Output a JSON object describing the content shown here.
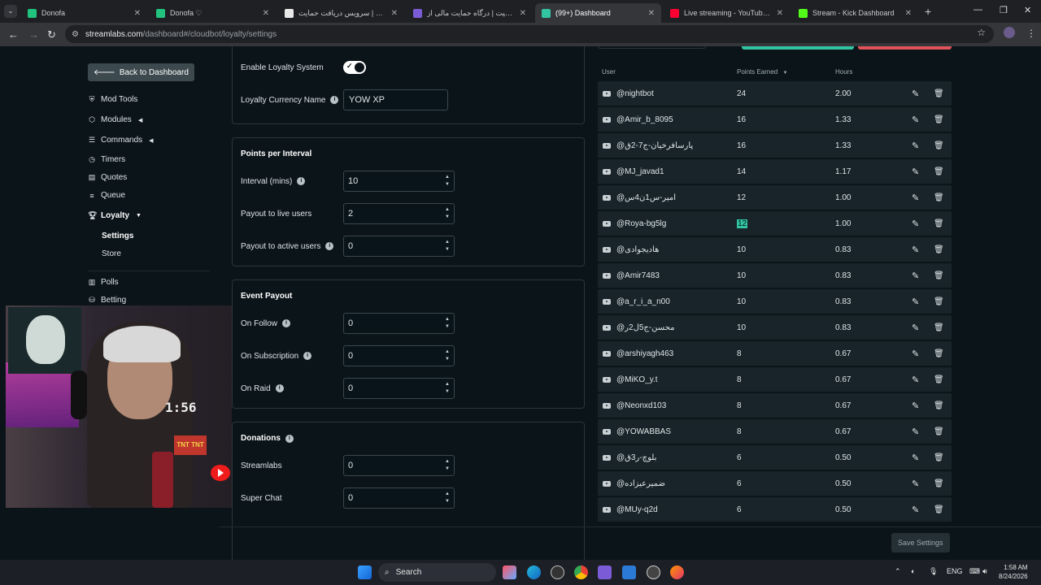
{
  "browser": {
    "tabs": [
      {
        "title": "Donofa",
        "color": "#21c37e"
      },
      {
        "title": "Donofa ♡",
        "color": "#21c37e"
      },
      {
        "title": "زیمیت | سرویس دریافت حمایت ...",
        "color": "#e8e8e8"
      },
      {
        "title": "زیمیت | درگاه حمایت مالی از yow",
        "color": "#7b5cd6"
      },
      {
        "title": "(99+) Dashboard",
        "color": "#31c3a2"
      },
      {
        "title": "Live streaming - YouTube Studio",
        "color": "#ff0033"
      },
      {
        "title": "Stream - Kick Dashboard",
        "color": "#53fc18"
      }
    ],
    "url_domain": "streamlabs.com",
    "url_path": "/dashboard#/cloudbot/loyalty/settings"
  },
  "sidebar": {
    "back_label": "Back to Dashboard",
    "items": [
      {
        "label": "Mod Tools",
        "icon": "shield-icon"
      },
      {
        "label": "Modules",
        "icon": "cube-icon"
      },
      {
        "label": "Commands",
        "icon": "list-icon"
      },
      {
        "label": "Timers",
        "icon": "clock-icon"
      },
      {
        "label": "Quotes",
        "icon": "quote-icon"
      },
      {
        "label": "Queue",
        "icon": "queue-icon"
      },
      {
        "label": "Loyalty",
        "icon": "trophy-icon"
      },
      {
        "label": "Polls",
        "icon": "bar-chart-icon"
      },
      {
        "label": "Betting",
        "icon": "coins-icon"
      }
    ],
    "loyalty_sub": [
      "Settings",
      "Store"
    ]
  },
  "settings": {
    "enable_label": "Enable Loyalty System",
    "enabled": true,
    "currency_label": "Loyalty Currency Name",
    "currency_value": "YOW XP",
    "points_per_interval": {
      "title": "Points per Interval",
      "fields": [
        {
          "label": "Interval (mins)",
          "value": "10",
          "info": true
        },
        {
          "label": "Payout to live users",
          "value": "2",
          "info": false
        },
        {
          "label": "Payout to active users",
          "value": "0",
          "info": true
        }
      ]
    },
    "event_payout": {
      "title": "Event Payout",
      "fields": [
        {
          "label": "On Follow",
          "value": "0",
          "info": true
        },
        {
          "label": "On Subscription",
          "value": "0",
          "info": true
        },
        {
          "label": "On Raid",
          "value": "0",
          "info": true
        }
      ]
    },
    "donations": {
      "title": "Donations",
      "fields": [
        {
          "label": "Streamlabs",
          "value": "0"
        },
        {
          "label": "Super Chat",
          "value": "0"
        }
      ]
    }
  },
  "table": {
    "headers": {
      "user": "User",
      "points": "Points Earned",
      "hours": "Hours"
    },
    "rows": [
      {
        "user": "@nightbot",
        "points": "24",
        "hours": "2.00"
      },
      {
        "user": "@Amir_b_8095",
        "points": "16",
        "hours": "1.33"
      },
      {
        "user": "@پارسافرخیان-ج7-2ق",
        "points": "16",
        "hours": "1.33"
      },
      {
        "user": "@MJ_javad1",
        "points": "14",
        "hours": "1.17"
      },
      {
        "user": "@امیر-س1ن4س",
        "points": "12",
        "hours": "1.00"
      },
      {
        "user": "@Roya-bg5lg",
        "points": "12",
        "hours": "1.00"
      },
      {
        "user": "@هادیجوادی",
        "points": "10",
        "hours": "0.83"
      },
      {
        "user": "@Amir7483",
        "points": "10",
        "hours": "0.83"
      },
      {
        "user": "@a_r_i_a_n00",
        "points": "10",
        "hours": "0.83"
      },
      {
        "user": "@محسن-ج5ل2ر",
        "points": "10",
        "hours": "0.83"
      },
      {
        "user": "@arshiyagh463",
        "points": "8",
        "hours": "0.67"
      },
      {
        "user": "@MiKO_y.t",
        "points": "8",
        "hours": "0.67"
      },
      {
        "user": "@Neonxd103",
        "points": "8",
        "hours": "0.67"
      },
      {
        "user": "@YOWABBAS",
        "points": "8",
        "hours": "0.67"
      },
      {
        "user": "@بلوچ-ر3ق",
        "points": "6",
        "hours": "0.50"
      },
      {
        "user": "@ضمیرعیزاده",
        "points": "6",
        "hours": "0.50"
      },
      {
        "user": "@MUy-q2d",
        "points": "6",
        "hours": "0.50"
      }
    ]
  },
  "save_label": "Save Settings",
  "webcam": {
    "clock": "1:56",
    "tnt": "TNT TNT"
  },
  "taskbar": {
    "search_label": "Search",
    "lang": "ENG",
    "time": "1:58 AM",
    "date": "8/24/2026"
  }
}
